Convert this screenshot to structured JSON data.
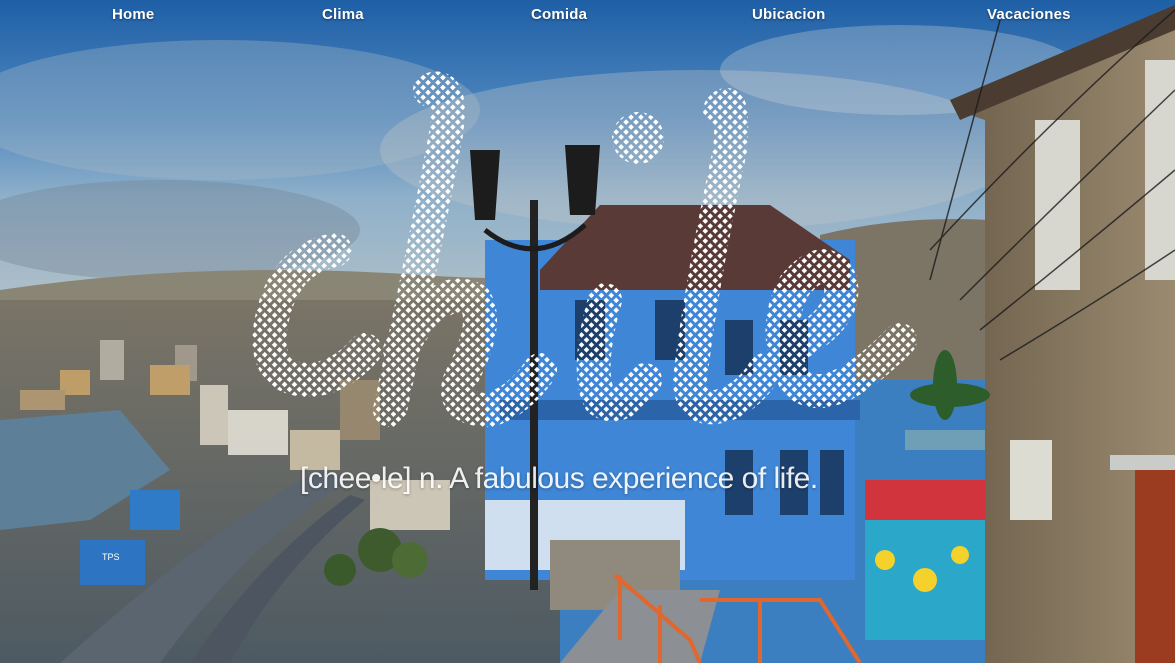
{
  "nav": {
    "items": [
      {
        "label": "Home"
      },
      {
        "label": "Clima"
      },
      {
        "label": "Comida"
      },
      {
        "label": "Ubicacion"
      },
      {
        "label": "Vacaciones"
      }
    ]
  },
  "hero": {
    "title": "chile",
    "tagline": "[chee•le] n. A fabulous experience of life."
  },
  "photo": {
    "signs": {
      "tps": "TPS"
    }
  },
  "colors": {
    "sky_top": "#2f6fb3",
    "sky_mid": "#6b9cc8",
    "house_blue": "#3f86d6",
    "wall_tan": "#8a7a62",
    "text": "#ffffff"
  }
}
